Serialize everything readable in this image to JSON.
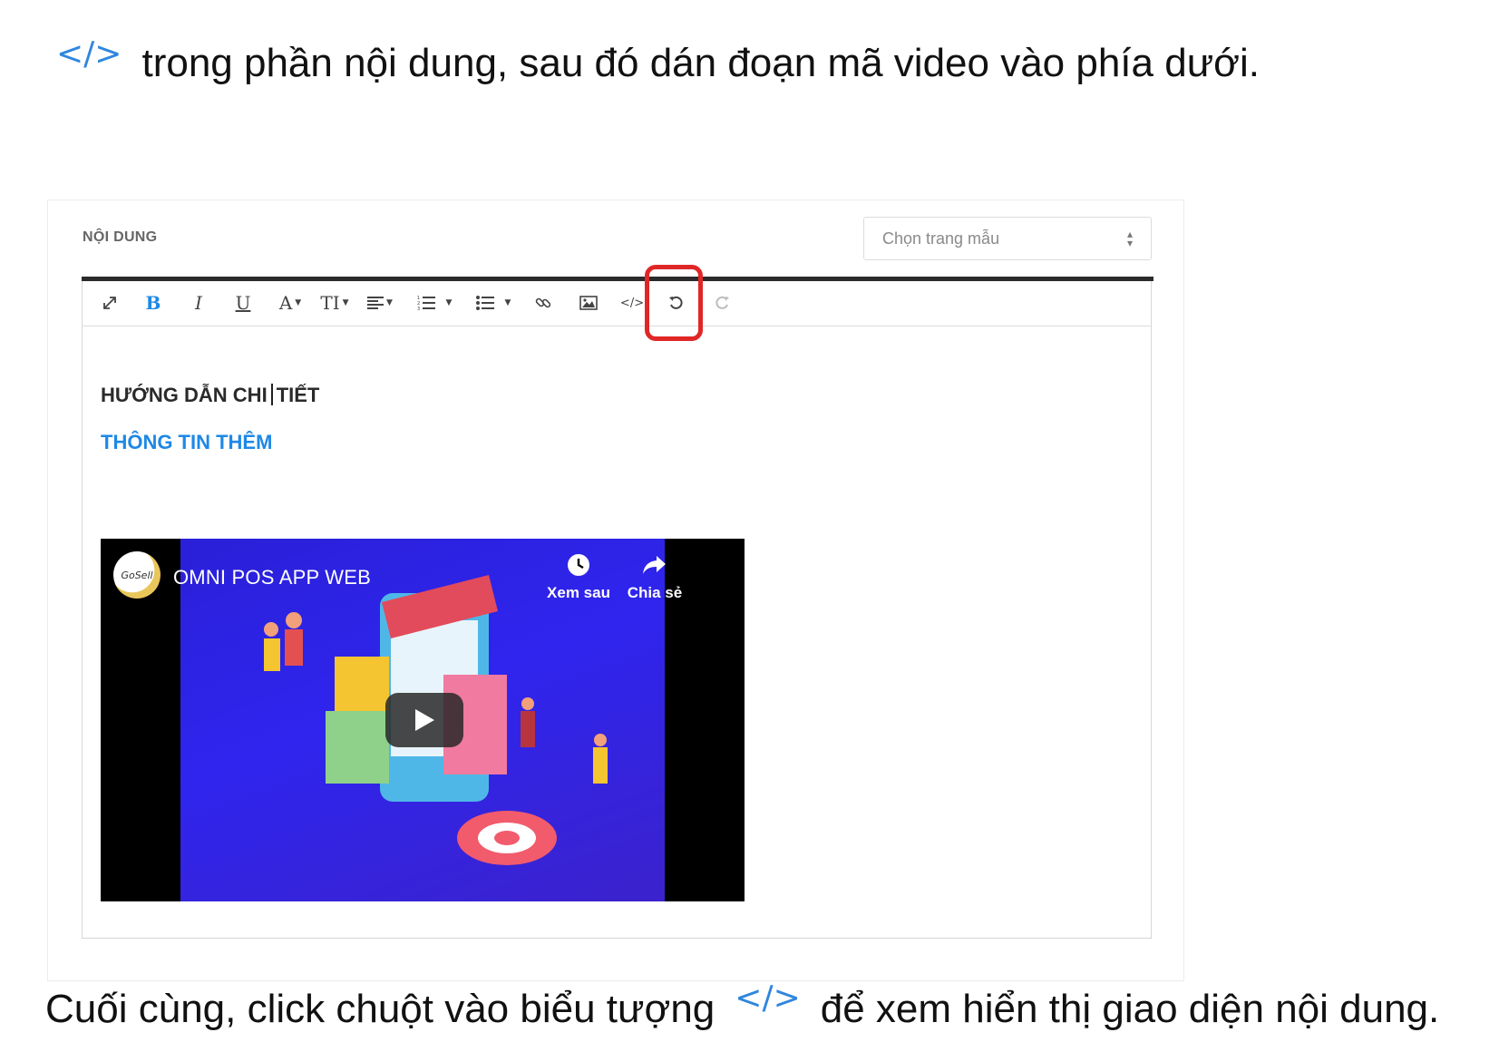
{
  "intro": {
    "text": "trong phần nội dung, sau đó dán đoạn mã video vào phía dưới."
  },
  "code_symbol": "</>",
  "section_label": "NỘI DUNG",
  "template_select": {
    "value": "Chọn trang mẫu"
  },
  "toolbar": {
    "bold": "B",
    "italic": "I",
    "underline": "U",
    "font_color": "A",
    "font_size": "TI"
  },
  "content": {
    "line1_part1": "HƯỚNG DẪN CHI",
    "line1_part2": "TIẾT",
    "line2": "THÔNG TIN THÊM"
  },
  "video": {
    "logo_text": "GoSell",
    "title": "OMNI POS APP WEB",
    "watch_later": "Xem sau",
    "share": "Chia sẻ"
  },
  "outro": {
    "before": "Cuối cùng, click chuột vào biểu tượng",
    "after": "để xem hiển thị giao diện nội dung."
  },
  "colors": {
    "accent_blue": "#1e88e5",
    "highlight_red": "#e02727",
    "video_bg": "#2f25ee"
  }
}
